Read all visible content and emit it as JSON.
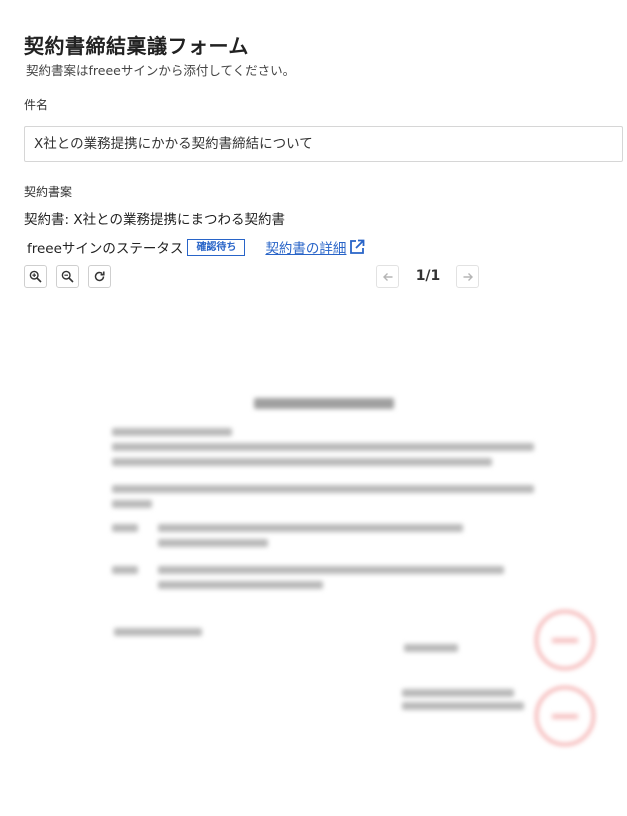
{
  "form": {
    "title": "契約書締結稟議フォーム",
    "subtitle": "契約書案はfreeeサインから添付してください。"
  },
  "subject": {
    "label": "件名",
    "value": "X社との業務提携にかかる契約書締結について"
  },
  "contract": {
    "label": "契約書案",
    "name": "契約書: X社との業務提携にまつわる契約書",
    "status_label": "freeeサインのステータス",
    "status_badge": "確認待ち",
    "detail_link": "契約書の詳細"
  },
  "viewer": {
    "page_counter": "1/1",
    "icons": [
      "zoom-in-icon",
      "zoom-out-icon",
      "rotate-icon",
      "arrow-left-icon",
      "arrow-right-icon",
      "external-link-icon"
    ]
  },
  "colors": {
    "accent": "#2864c8",
    "stamp": "#f3aaaa"
  }
}
